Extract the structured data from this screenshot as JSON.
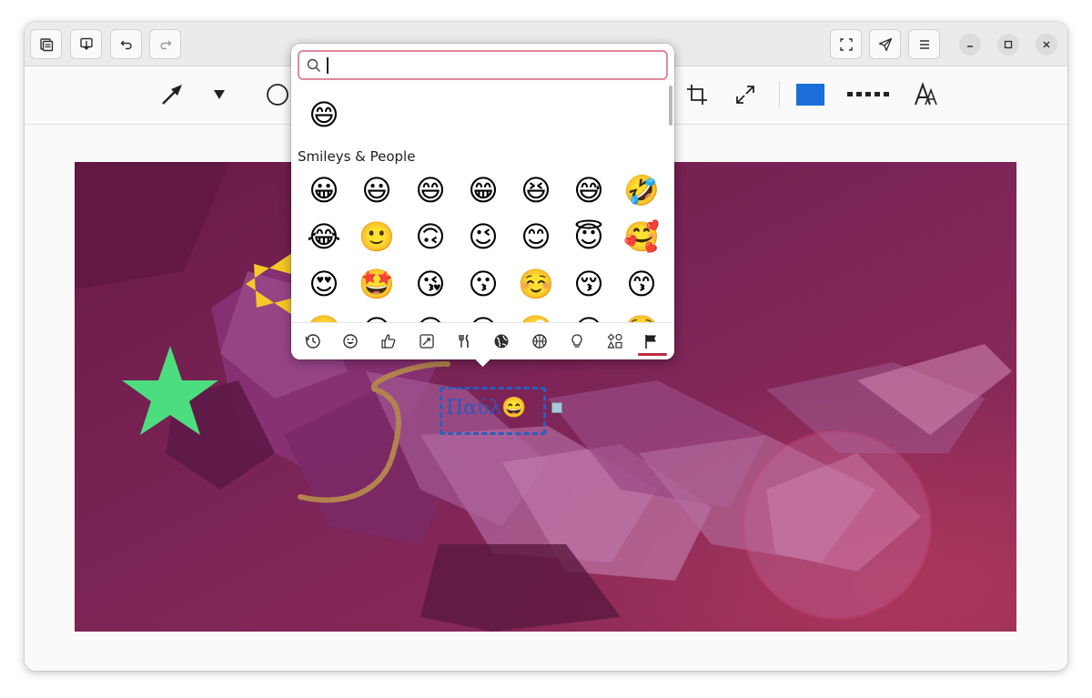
{
  "window": {
    "header_buttons": [
      "pages-icon",
      "save-to-image-icon",
      "undo-icon",
      "redo-icon"
    ],
    "right_buttons": [
      "fullscreen-icon",
      "share-icon",
      "menu-icon"
    ],
    "window_controls": [
      "minimize-icon",
      "maximize-icon",
      "close-icon"
    ]
  },
  "toolbar": {
    "tools": [
      "arrow-tool-icon",
      "tool-dropdown-icon",
      "circle-tool-icon",
      "crop-icon",
      "expand-icon"
    ],
    "color": "#1c6fd8",
    "line_style": "dotted-line-icon",
    "font_tool": "font-icon"
  },
  "emoji_picker": {
    "search_placeholder": "",
    "search_value": "",
    "recent": [
      "😄"
    ],
    "section_title": "Smileys & People",
    "rows": [
      [
        "😀",
        "😃",
        "😄",
        "😁",
        "😆",
        "😅",
        "🤣"
      ],
      [
        "😂",
        "🙂",
        "🙃",
        "😉",
        "😊",
        "😇",
        "🥰"
      ],
      [
        "😍",
        "🤩",
        "😘",
        "😗",
        "☺️",
        "😚",
        "😙"
      ],
      [
        "🥲",
        "😋",
        "😛",
        "😜",
        "🤪",
        "😝",
        "🤑"
      ]
    ],
    "categories": [
      "recent-icon",
      "smileys-icon",
      "people-icon",
      "nature-icon",
      "food-icon",
      "travel-icon",
      "activities-icon",
      "objects-icon",
      "symbols-icon",
      "flags-icon"
    ],
    "selected_category": "flags-icon"
  },
  "annotation": {
    "text": "Παύλ😄"
  }
}
